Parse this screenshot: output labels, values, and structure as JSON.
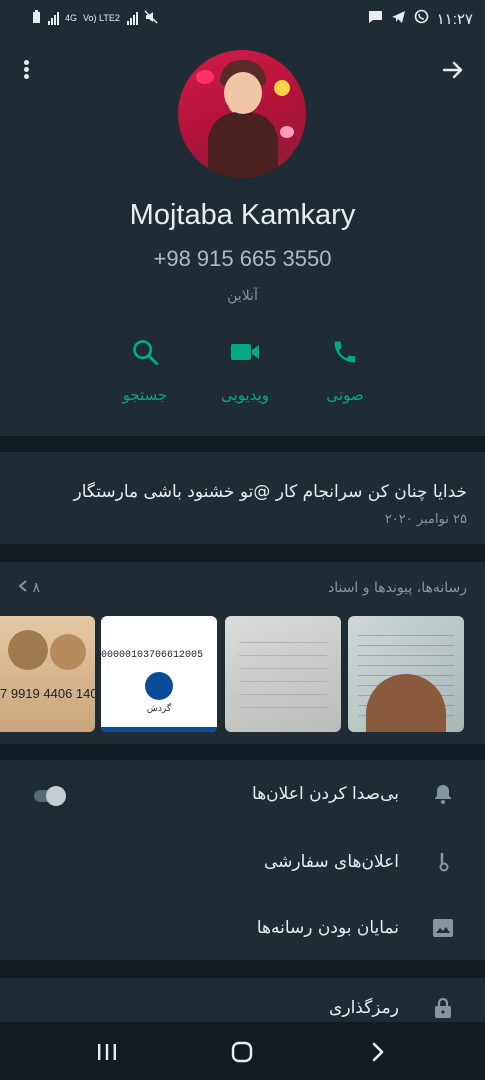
{
  "status_bar": {
    "time": "۱۱:۲۷",
    "network_left": "4G",
    "network_right": "Vo) LTE2"
  },
  "profile": {
    "name": "Mojtaba Kamkary",
    "phone": "+98 915 665 3550",
    "status": "آنلاین"
  },
  "actions": [
    {
      "label": "صوتی",
      "icon": "phone-icon"
    },
    {
      "label": "ویدیویی",
      "icon": "video-icon"
    },
    {
      "label": "جستجو",
      "icon": "search-icon"
    }
  ],
  "about": {
    "text": "خدایا چنان کن سرانجام کار @تو خشنود باشی مارستگار",
    "date": "۲۵ نوامبر ۲۰۲۰"
  },
  "media": {
    "title": "رسانه‌ها، پیوندها و اسناد",
    "count": "۸",
    "thumb3_number": "00000103706612005",
    "thumb3_label": "گردش",
    "thumb4_number": "7 9919 4406 140"
  },
  "settings": {
    "mute": "بی‌صدا کردن اعلان‌ها",
    "custom_notifications": "اعلان‌های سفارشی",
    "media_visibility": "نمایان بودن رسانه‌ها",
    "encryption": "رمزگذاری"
  },
  "colors": {
    "accent": "#00a884",
    "panel": "#1f2c34",
    "background": "#121b22"
  }
}
